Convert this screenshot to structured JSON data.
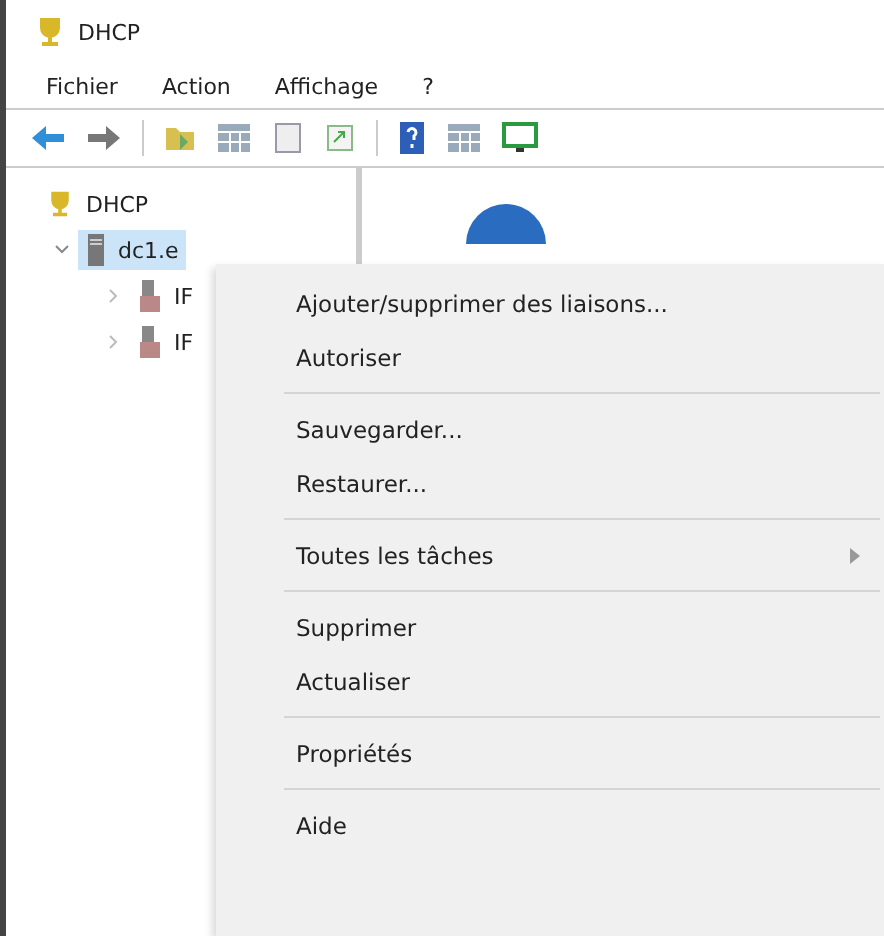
{
  "window": {
    "title": "DHCP"
  },
  "menu_bar": [
    "Fichier",
    "Action",
    "Affichage",
    "?"
  ],
  "tree": [
    {
      "label": "DHCP",
      "selected": false,
      "children": [
        {
          "label": "dc1.e",
          "selected": true,
          "expanded": true,
          "children": [
            {
              "label": "IF",
              "selected": false,
              "expanded": false
            },
            {
              "label": "IF",
              "selected": false,
              "expanded": false
            }
          ]
        }
      ]
    }
  ],
  "context_menu": [
    [
      {
        "label": "Ajouter/supprimer des liaisons...",
        "kind": "command"
      },
      {
        "label": "Autoriser",
        "kind": "command"
      }
    ],
    [
      {
        "label": "Sauvegarder...",
        "kind": "command"
      },
      {
        "label": "Restaurer...",
        "kind": "command"
      }
    ],
    [
      {
        "label": "Toutes les tâches",
        "kind": "submenu"
      }
    ],
    [
      {
        "label": "Supprimer",
        "kind": "command"
      },
      {
        "label": "Actualiser",
        "kind": "command"
      }
    ],
    [
      {
        "label": "Propriétés",
        "kind": "command"
      }
    ],
    [
      {
        "label": "Aide",
        "kind": "command"
      }
    ]
  ]
}
